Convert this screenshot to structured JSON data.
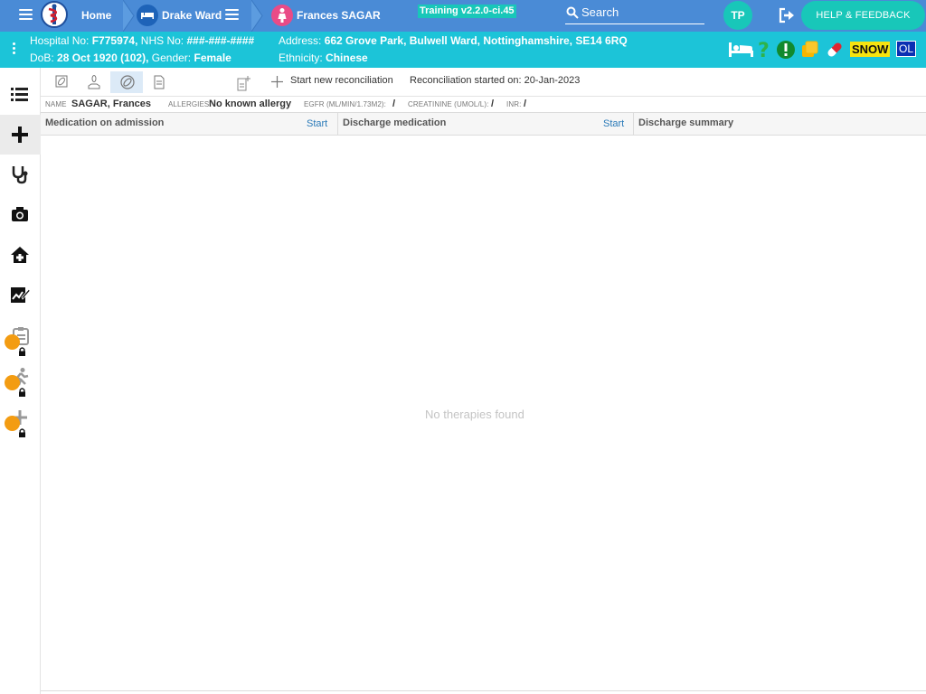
{
  "nav": {
    "home_label": "Home",
    "ward_label": "Drake Ward",
    "patient_label": "Frances SAGAR",
    "training_badge": "Training v2.2.0-ci.45",
    "search_placeholder": "Search",
    "user_initials": "TP",
    "help_label": "HELP & FEEDBACK"
  },
  "banner": {
    "hospital_label": "Hospital No:",
    "hospital_no": "F775974,",
    "nhs_label": "NHS No:",
    "nhs_no": "###-###-####",
    "dob_label": "DoB:",
    "dob": "28 Oct 1920 (102),",
    "gender_label": "Gender:",
    "gender": "Female",
    "address_label": "Address:",
    "address": "662 Grove Park, Bulwell Ward, Nottinghamshire, SE14 6RQ",
    "ethnicity_label": "Ethnicity:",
    "ethnicity": "Chinese",
    "snow_badge": "SNOW",
    "ol_badge": "OL"
  },
  "toolbar": {
    "new_reconciliation_label": "Start new reconciliation",
    "reconciliation_started": "Reconciliation started on: 20-Jan-2023"
  },
  "info": {
    "name_label": "NAME",
    "name": "SAGAR, Frances",
    "allergies_label": "ALLERGIES:",
    "allergies": "No known allergy",
    "egfr_label": "EGFR (ML/MIN/1.73M2):",
    "egfr": "/",
    "creatinine_label": "CREATININE (UMOL/L):",
    "creatinine": "/",
    "inr_label": "INR:",
    "inr": "/"
  },
  "columns": {
    "admission": {
      "title": "Medication on admission",
      "start_label": "Start"
    },
    "discharge": {
      "title": "Discharge medication",
      "start_label": "Start"
    },
    "summary": {
      "title": "Discharge summary"
    }
  },
  "empty_message": "No therapies found",
  "colors": {
    "nav_bg": "#4a8bd6",
    "banner_bg": "#1cc4d8",
    "accent_teal": "#18c7b9",
    "patient_pink": "#e94b87",
    "lock_orange": "#f39c12"
  }
}
